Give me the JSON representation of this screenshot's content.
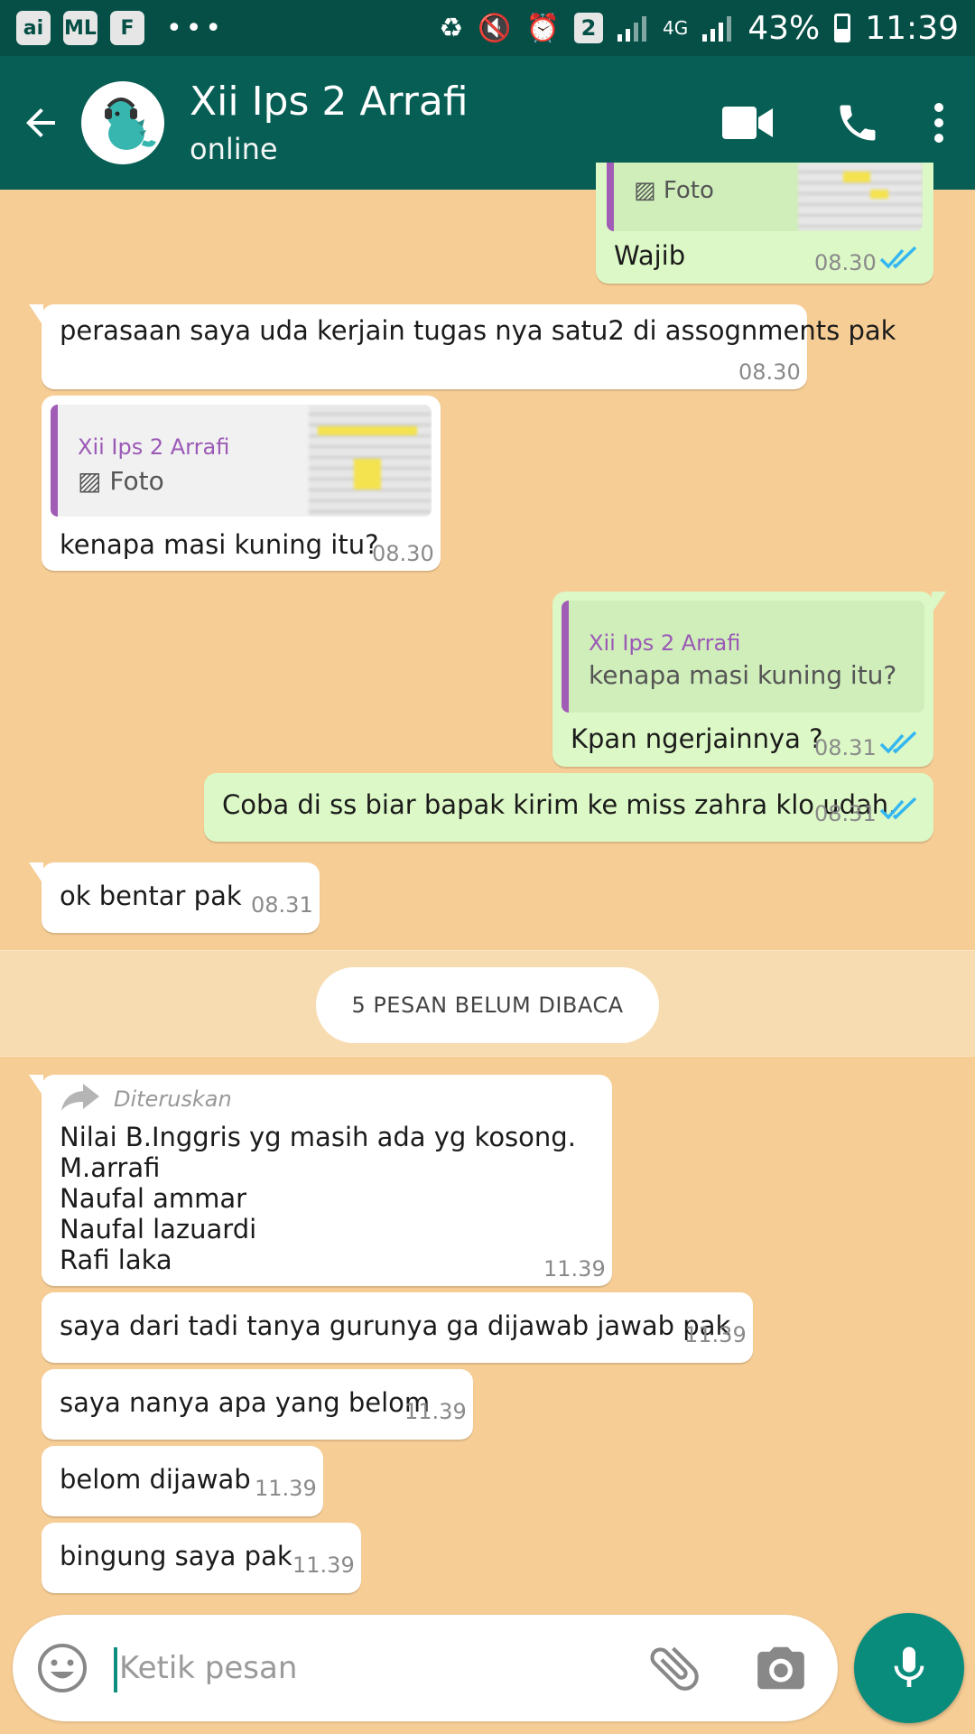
{
  "status_bar": {
    "signal_label": "4G",
    "sim_badge": "2",
    "battery": "43%",
    "time": "11:39"
  },
  "header": {
    "title": "Xii Ips 2 Arrafi",
    "subtitle": "online"
  },
  "messages": [
    {
      "id": "m0",
      "direction": "out",
      "quote_text": "Foto",
      "text": "Wajib",
      "time": "08.30",
      "read": true
    },
    {
      "id": "m1",
      "direction": "in",
      "text": "perasaan saya uda kerjain tugas nya satu2 di assognments pak",
      "time": "08.30"
    },
    {
      "id": "m2",
      "direction": "in",
      "quote_name": "Xii Ips 2 Arrafi",
      "quote_text": "Foto",
      "text": "kenapa masi kuning itu?",
      "time": "08.30"
    },
    {
      "id": "m3",
      "direction": "out",
      "quote_name": "Xii Ips 2 Arrafi",
      "quote_text": "kenapa masi kuning itu?",
      "text": "Kpan ngerjainnya ?",
      "time": "08.31",
      "read": true
    },
    {
      "id": "m4",
      "direction": "out",
      "text": "Coba di ss biar bapak kirim ke miss zahra klo udah.",
      "time": "08.31",
      "read": true
    },
    {
      "id": "m5",
      "direction": "in",
      "text": "ok bentar pak",
      "time": "08.31"
    },
    {
      "id": "m6",
      "direction": "in",
      "forwarded_label": "Diteruskan",
      "lines": [
        "Nilai B.Inggris yg masih ada yg kosong.",
        "M.arrafi",
        "Naufal ammar",
        "Naufal lazuardi",
        "Rafi laka"
      ],
      "time": "11.39"
    },
    {
      "id": "m7",
      "direction": "in",
      "text": "saya dari tadi tanya gurunya ga dijawab jawab pak",
      "time": "11.39"
    },
    {
      "id": "m8",
      "direction": "in",
      "text": "saya nanya apa yang belom",
      "time": "11.39"
    },
    {
      "id": "m9",
      "direction": "in",
      "text": "belom dijawab",
      "time": "11.39"
    },
    {
      "id": "m10",
      "direction": "in",
      "text": "bingung saya pak",
      "time": "11.39"
    }
  ],
  "unread_banner": "5 PESAN BELUM DIBACA",
  "input": {
    "placeholder": "Ketik pesan"
  },
  "colors": {
    "header": "#075e54",
    "status_bar": "#054f46",
    "background": "#f6cd95",
    "outgoing_bubble": "#dcf8c6",
    "incoming_bubble": "#ffffff",
    "read_ticks": "#34b7f1",
    "quote_bar": "#a15cb6",
    "mic_button": "#0a8c7d"
  }
}
